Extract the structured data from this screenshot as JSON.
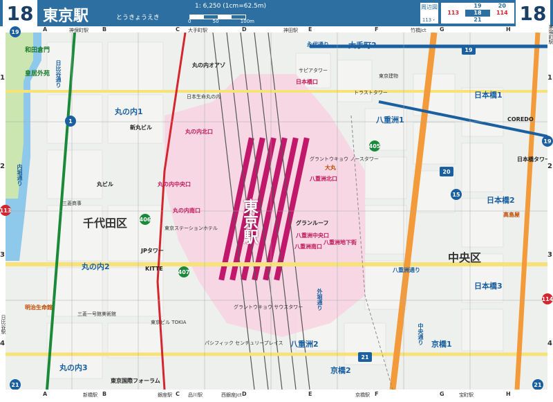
{
  "header": {
    "page_number": "18",
    "station_title": "東京駅",
    "station_kana": "とうきょうえき",
    "scale_label": "1: 6,250 (1cm=62.5m)",
    "scale_ticks": [
      "0",
      "50",
      "100m"
    ],
    "nearby_label": "周辺図",
    "nearby_range": "113・114",
    "nearby_pages": [
      "",
      "19",
      "20",
      "113",
      "18",
      "114",
      "",
      "21",
      ""
    ]
  },
  "grid": {
    "columns": [
      "A",
      "B",
      "C",
      "D",
      "E",
      "F",
      "G",
      "H"
    ],
    "rows": [
      "1",
      "2",
      "3",
      "4"
    ]
  },
  "edges": {
    "top_left": "19",
    "top_right": "19",
    "bottom_left": "21",
    "bottom_right": "21",
    "left": "113",
    "right": "114",
    "top_labels": [
      "神保町駅",
      "大手町駅",
      "神田駅",
      "竹橋Jct"
    ],
    "bottom_labels": [
      "新橋駅",
      "銀座駅",
      "品川駅",
      "西銀座Jct",
      "京橋駅",
      "宝町駅"
    ],
    "side_labels": [
      "日比谷駅",
      "茅場町駅"
    ]
  },
  "areas": {
    "chiyoda": "千代田区",
    "chuo": "中央区",
    "marunouchi1": "丸の内1",
    "marunouchi2": "丸の内2",
    "marunouchi3": "丸の内3",
    "yaesu1": "八重洲1",
    "yaesu2": "八重洲2",
    "nihonbashi1": "日本橋1",
    "nihonbashi2": "日本橋2",
    "nihonbashi3": "日本橋3",
    "kyobashi1": "京橋1",
    "kyobashi2": "京橋2",
    "otemachi2": "大手町2",
    "tokyo_station_big": "東京駅"
  },
  "roads": {
    "eitai": "永代通り",
    "sotobori": "外堀通り",
    "chuo_dori": "中央通り",
    "yaesu_dori": "八重洲通り",
    "uchibori": "内堀通り",
    "hibiya": "日比谷通り"
  },
  "routes": {
    "r1": "1",
    "r15": "15",
    "r19": "19",
    "r20": "20",
    "r21": "21",
    "r405": "405",
    "r406": "406",
    "r407": "407"
  },
  "landmarks": {
    "maru_biru": "丸ビル",
    "shinmaru": "新丸ビル",
    "oazo": "丸の内オアゾ",
    "kitte": "KITTE",
    "jp_tower": "JPタワー",
    "tokyo_forum": "東京国際フォーラム",
    "daimaru": "大丸",
    "takashimaya": "高島屋",
    "coredo": "COREDO",
    "gran_tokyo_n": "グラントウキョウ ノースタワー",
    "gran_tokyo_s": "グラントウキョウ サウスタワー",
    "granroof": "グランルーフ",
    "sapia": "サピアタワー",
    "kokyo_gaien": "皇居外苑",
    "wadakura": "和田倉門",
    "nihon_seimei": "日本生命丸の内",
    "mitsubishi_shoji": "三菱商事",
    "tokyo_building": "東京ビル TOKIA",
    "ichigokan": "三菱一号館美術館",
    "trust_tower": "トラストタワー",
    "yaesu_chika": "八重洲地下街",
    "station_hotel": "東京ステーションホテル",
    "meiji_seimei": "明治生命館",
    "nihonbashi_tower": "日本橋タワー",
    "tokyo_tatemono": "東京建物",
    "pacific_century": "パシフィック センチュリープレイス"
  },
  "exits": {
    "marunouchi_north": "丸の内北口",
    "marunouchi_central": "丸の内中央口",
    "marunouchi_south": "丸の内南口",
    "yaesu_north": "八重洲北口",
    "yaesu_central": "八重洲中央口",
    "yaesu_south": "八重洲南口",
    "nihonbashi_exit": "日本橋口"
  },
  "colors": {
    "header_blue": "#2d6fa0",
    "rail_magenta": "#c2186b",
    "station_pink": "#f7d2e0",
    "road_yellow": "#f7e27a",
    "road_orange": "#f39a3a",
    "water_blue": "#8ec8ea",
    "park_green": "#cbe6b0"
  }
}
